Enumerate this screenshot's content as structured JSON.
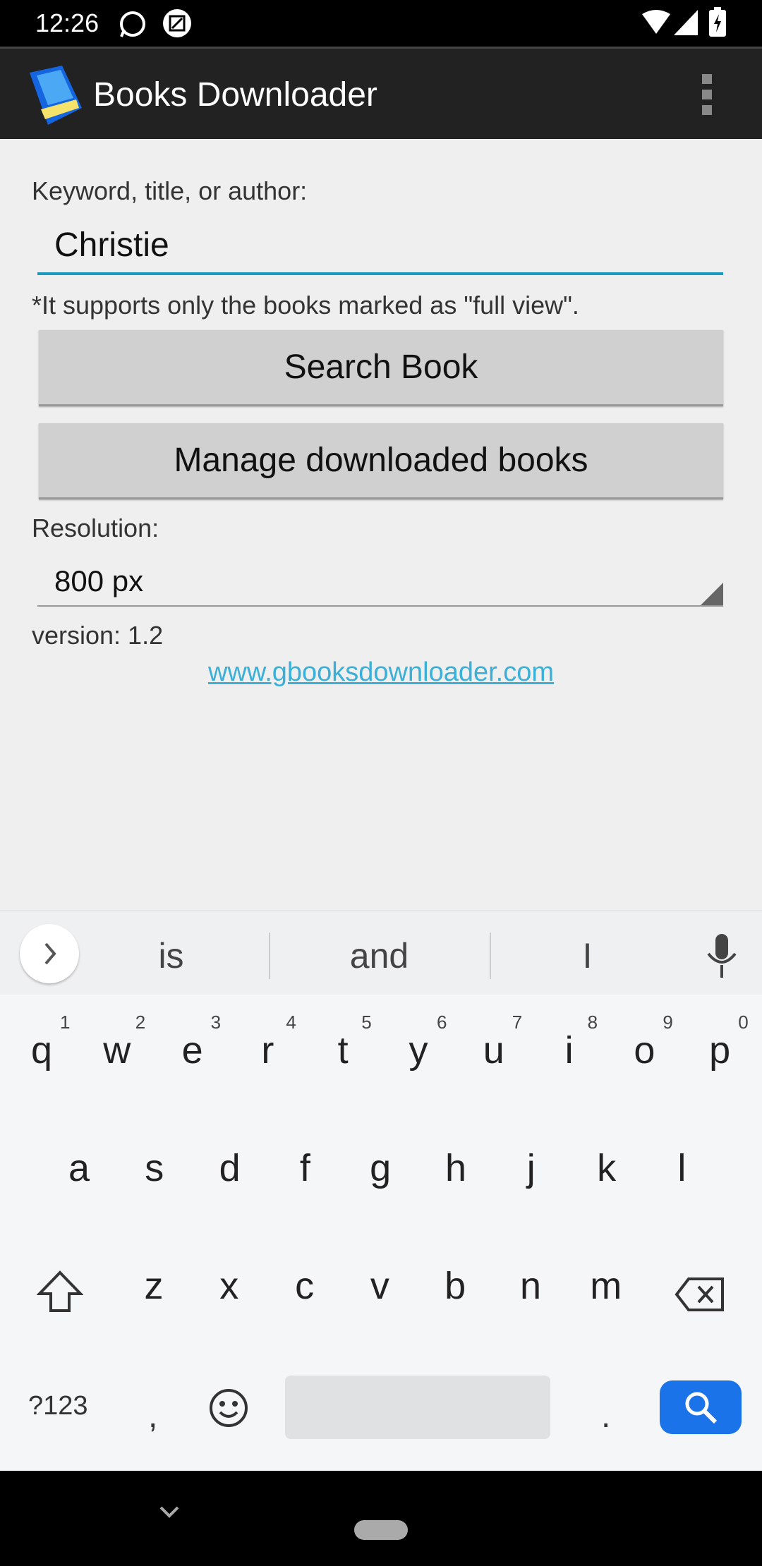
{
  "status_bar": {
    "time": "12:26",
    "icons": [
      "whatsapp-icon",
      "screenshot-edit-icon",
      "wifi-icon",
      "signal-icon",
      "battery-charging-icon"
    ]
  },
  "app_bar": {
    "title": "Books Downloader",
    "icon": "book-icon",
    "menu_icon": "more-vert-icon"
  },
  "form": {
    "search_label": "Keyword, title, or author:",
    "search_value": "Christie",
    "note": "*It supports only the books marked as \"full view\".",
    "search_button": "Search Book",
    "manage_button": "Manage downloaded books",
    "resolution_label": "Resolution:",
    "resolution_value": "800 px",
    "version": "version: 1.2",
    "link": "www.gbooksdownloader.com"
  },
  "colors": {
    "accent": "#1a9bbf",
    "link": "#3ab0d8",
    "search_key": "#1a73e8"
  },
  "keyboard": {
    "suggestions": [
      "is",
      "and",
      "I"
    ],
    "row1": [
      "q",
      "w",
      "e",
      "r",
      "t",
      "y",
      "u",
      "i",
      "o",
      "p"
    ],
    "row1_numbers": [
      "1",
      "2",
      "3",
      "4",
      "5",
      "6",
      "7",
      "8",
      "9",
      "0"
    ],
    "row2": [
      "a",
      "s",
      "d",
      "f",
      "g",
      "h",
      "j",
      "k",
      "l"
    ],
    "row3": [
      "z",
      "x",
      "c",
      "v",
      "b",
      "n",
      "m"
    ],
    "symbols_key": "?123",
    "comma": ",",
    "period": "."
  }
}
